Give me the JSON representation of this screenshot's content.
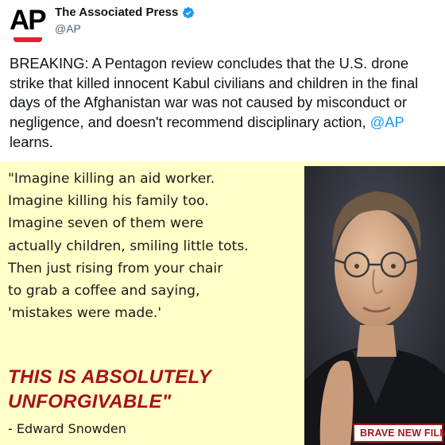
{
  "tweet": {
    "logo": "AP",
    "account_name": "The Associated Press",
    "handle": "@AP",
    "text_before_mention": "BREAKING: A Pentagon review concludes that the U.S. drone strike that killed innocent Kabul civilians and children in the final days of the Afghanistan war was not caused by misconduct or negligence, and doesn't recommend disciplinary action, ",
    "mention": "@AP",
    "text_after_mention": " learns."
  },
  "quote": {
    "text": "\"Imagine killing an aid worker.\nImagine killing his family too.\nImagine seven of them were\nactually children, smiling little tots.\nThen just rising from your chair\nto grab a coffee and saying,\n'mistakes were made.'",
    "emphasis": "THIS IS ABSOLUTELY\nUNFORGIVABLE\"",
    "attribution": "- Edward Snowden"
  },
  "branding": {
    "label": "BRAVE NEW FILMS"
  },
  "colors": {
    "ap_red": "#e4202c",
    "verified_blue": "#1d9bf0",
    "quote_background": "#ffffc8",
    "emphasis_red": "#a8111b",
    "brand_red": "#9e1b1b"
  },
  "icons": [
    "ap-logo",
    "verified-badge-icon",
    "film-strip-icon"
  ]
}
